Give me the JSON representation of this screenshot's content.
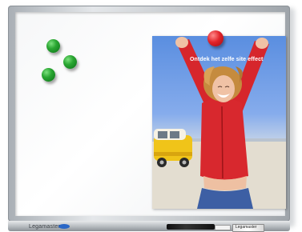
{
  "poster": {
    "headline": "Ontdek het zelfe site effect"
  },
  "brand": {
    "logo_text": "Legamaster",
    "eraser_text": "Legamaster"
  },
  "colors": {
    "magnet_green": "#2aa632",
    "magnet_red": "#e2242a",
    "frame": "#c4c8cc",
    "board": "#ffffff",
    "brand_blue": "#2a67c6"
  },
  "magnets": [
    {
      "color": "green"
    },
    {
      "color": "green"
    },
    {
      "color": "green"
    },
    {
      "color": "red"
    }
  ]
}
